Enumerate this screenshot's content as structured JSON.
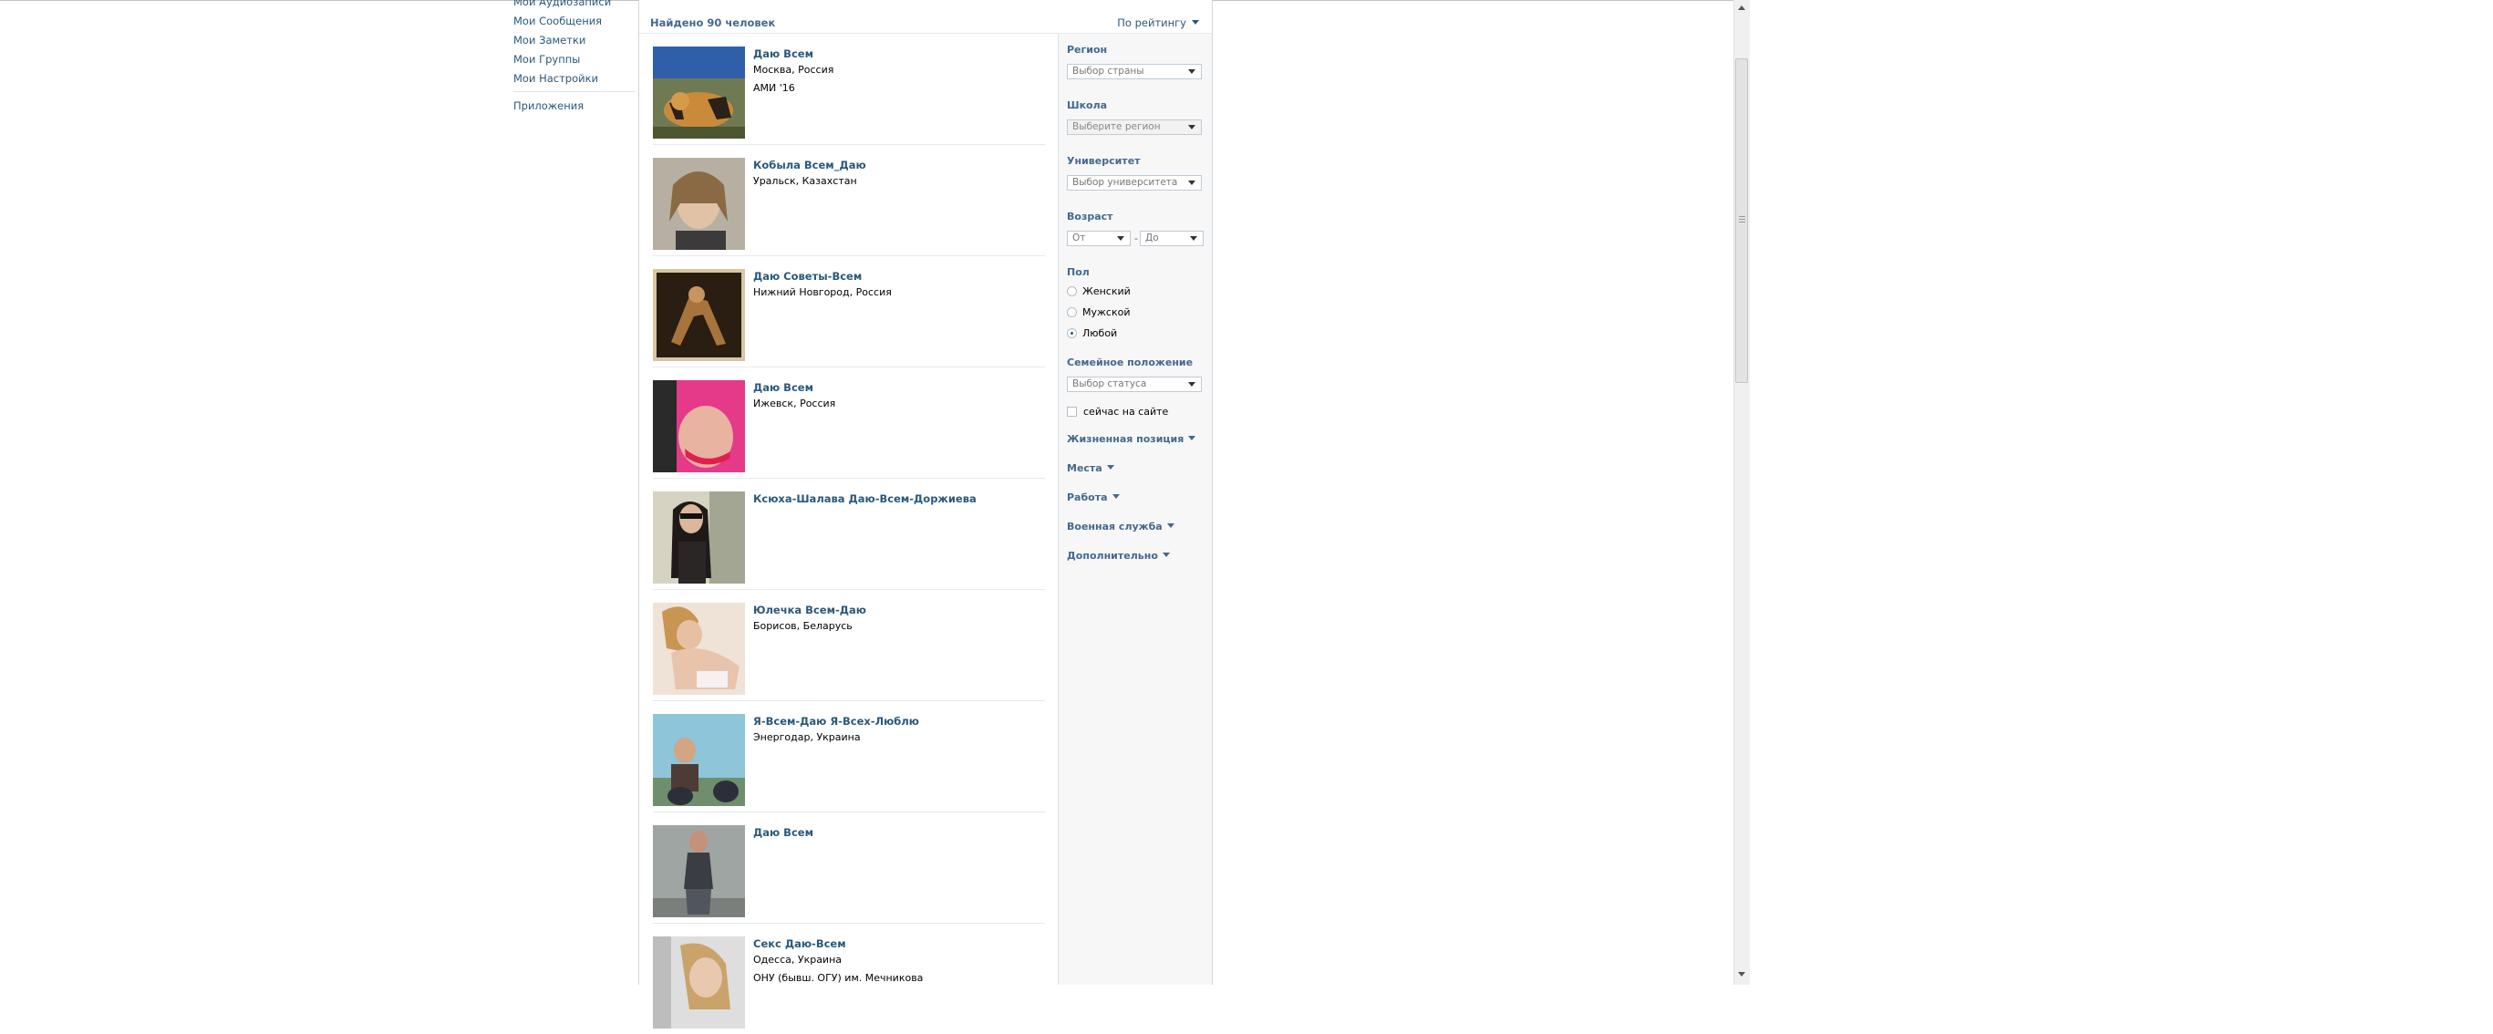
{
  "left_menu": {
    "items": [
      "Мои Аудиозаписи",
      "Мои Сообщения",
      "Мои Заметки",
      "Мои Группы",
      "Мои Настройки"
    ],
    "apps": "Приложения"
  },
  "summary": {
    "found": "Найдено 90 человек",
    "sort": "По рейтингу"
  },
  "results": [
    {
      "name": "Даю Всем",
      "lines": [
        "Москва, Россия",
        "АМИ '16"
      ]
    },
    {
      "name": "Кобыла Всем_Даю",
      "lines": [
        "Уральск, Казахстан"
      ]
    },
    {
      "name": "Даю Советы-Всем",
      "lines": [
        "Нижний Новгород, Россия"
      ]
    },
    {
      "name": "Даю Всем",
      "lines": [
        "Ижевск, Россия"
      ]
    },
    {
      "name": "Ксюха-Шалава Даю-Всем-Доржиева",
      "lines": []
    },
    {
      "name": "Юлечка Всем-Даю",
      "lines": [
        "Борисов, Беларусь"
      ]
    },
    {
      "name": "Я-Всем-Даю Я-Всех-Люблю",
      "lines": [
        "Энергодар, Украина"
      ]
    },
    {
      "name": "Даю Всем",
      "lines": []
    },
    {
      "name": "Секс Даю-Всем",
      "lines": [
        "Одесса, Украина",
        "ОНУ (бывш. ОГУ) им. Мечникова"
      ]
    }
  ],
  "filters": {
    "region_title": "Регион",
    "region_select": "Выбор страны",
    "school_title": "Школа",
    "school_select": "Выберите регион",
    "university_title": "Университет",
    "university_select": "Выбор университета",
    "age_title": "Возраст",
    "age_from": "От",
    "age_dash": "-",
    "age_to": "До",
    "sex_title": "Пол",
    "sex_options": [
      "Женский",
      "Мужской",
      "Любой"
    ],
    "sex_selected": "Любой",
    "status_title": "Семейное положение",
    "status_select": "Выбор статуса",
    "online_label": "сейчас на сайте",
    "toggles": [
      "Жизненная позиция",
      "Места",
      "Работа",
      "Военная служба",
      "Дополнительно"
    ]
  },
  "colors": {
    "link": "#2b587a",
    "heading": "#45688e",
    "filter_bg": "#f7f7f7"
  }
}
